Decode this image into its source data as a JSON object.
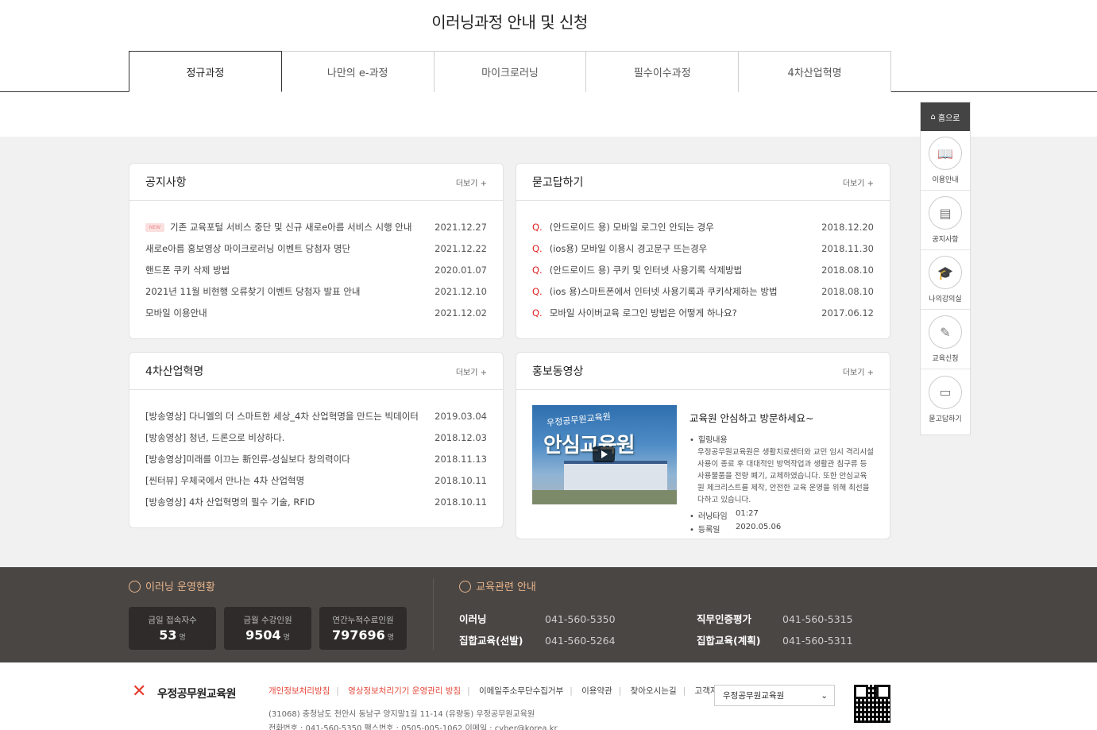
{
  "page_title": "이러닝과정 안내 및 신청",
  "tabs": [
    {
      "label": "정규과정"
    },
    {
      "label": "나만의 e-과정"
    },
    {
      "label": "마이크로러닝"
    },
    {
      "label": "필수이수과정"
    },
    {
      "label": "4차산업혁명"
    }
  ],
  "notice": {
    "title": "공지사항",
    "more": "더보기 +",
    "new_badge": "NEW",
    "items": [
      {
        "title": "기존 교육포털 서비스 중단 및 신규 새로e아름 서비스 시행 안내",
        "date": "2021.12.27"
      },
      {
        "title": "새로e아름 홍보영상 마이크로러닝 이벤트 당첨자 명단",
        "date": "2021.12.22"
      },
      {
        "title": "핸드폰 쿠키 삭제 방법",
        "date": "2020.01.07"
      },
      {
        "title": "2021년 11월 비현행 오류찾기 이벤트 당첨자 발표 안내",
        "date": "2021.12.10"
      },
      {
        "title": "모바일 이용안내",
        "date": "2021.12.02"
      }
    ]
  },
  "qna": {
    "title": "묻고답하기",
    "more": "더보기 +",
    "q_mark": "Q.",
    "items": [
      {
        "title": "(안드로이드 용) 모바일 로그인 안되는 경우",
        "date": "2018.12.20"
      },
      {
        "title": "(ios용) 모바일 이용시 경고문구 뜨는경우",
        "date": "2018.11.30"
      },
      {
        "title": "(안드로이드 용) 쿠키 및 인터넷 사용기록 삭제방법",
        "date": "2018.08.10"
      },
      {
        "title": "(ios 용)스마트폰에서 인터넷 사용기록과 쿠키삭제하는 방법",
        "date": "2018.08.10"
      },
      {
        "title": "모바일 사이버교육 로그인 방법은 어떻게 하나요?",
        "date": "2017.06.12"
      }
    ]
  },
  "industry": {
    "title": "4차산업혁명",
    "more": "더보기 +",
    "items": [
      {
        "title": "[방송영상] 다니엘의 더 스마트한 세상_4차 산업혁명을 만드는 빅데이터",
        "date": "2019.03.04"
      },
      {
        "title": "[방송영상] 청년, 드론으로 비상하다.",
        "date": "2018.12.03"
      },
      {
        "title": "[방송영상]미래를 이끄는 新인류-성실보다 창의력이다",
        "date": "2018.11.13"
      },
      {
        "title": "[씬터뷰] 우체국에서 만나는 4차 산업혁명",
        "date": "2018.10.11"
      },
      {
        "title": "[방송영상] 4차 산업혁명의 필수 기술, RFID",
        "date": "2018.10.11"
      }
    ]
  },
  "video": {
    "title": "홍보동영상",
    "more": "더보기 +",
    "thumb_sub": "우정공무원교육원",
    "thumb_main": "안심교육원",
    "video_title": "교육원 안심하고 방문하세요~",
    "content_label": "힐링내용",
    "content": "우정공무원교육원은 생활치료센터와 교민 임시 격리시설 사용이 종료 후 대대적인 방역작업과 생활관 침구류 등 사용물품을 전량 폐기, 교체하였습니다. 또한 안심교육원 체크리스트를 제작, 안전한 교육 운영을 위해 최선을 다하고 있습니다.",
    "runtime_label": "러닝타임",
    "runtime": "01:27",
    "reg_label": "등록일",
    "reg_date": "2020.05.06"
  },
  "quick": {
    "home": "홈으로",
    "items": [
      {
        "label": "이용안내",
        "icon": "book-icon"
      },
      {
        "label": "공지사항",
        "icon": "notice-icon"
      },
      {
        "label": "나의강의실",
        "icon": "graduation-icon"
      },
      {
        "label": "교육신청",
        "icon": "pencil-icon"
      },
      {
        "label": "묻고답하기",
        "icon": "monitor-icon"
      }
    ]
  },
  "footer": {
    "status_title": "이러닝 운영현황",
    "stats": [
      {
        "label": "금일 접속자수",
        "value": "53",
        "unit": "명"
      },
      {
        "label": "금월 수강인원",
        "value": "9504",
        "unit": "명"
      },
      {
        "label": "연간누적수료인원",
        "value": "797696",
        "unit": "명"
      }
    ],
    "contact_title": "교육관련 안내",
    "contacts": [
      {
        "label": "이러닝",
        "phone": "041-560-5350"
      },
      {
        "label": "집합교육(선발)",
        "phone": "041-560-5264"
      },
      {
        "label": "직무인증평가",
        "phone": "041-560-5315"
      },
      {
        "label": "집합교육(계획)",
        "phone": "041-560-5311"
      }
    ],
    "logo_text": "우정공무원교육원",
    "links": [
      {
        "label": "개인정보처리방침",
        "red": true
      },
      {
        "label": "영상정보처리기기 운영관리 방침",
        "red": true
      },
      {
        "label": "이메일주소무단수집거부",
        "red": false
      },
      {
        "label": "이용약관",
        "red": false
      },
      {
        "label": "찾아오시는길",
        "red": false
      },
      {
        "label": "고객지",
        "red": false
      }
    ],
    "address": "(31068) 충청남도 천안시 동남구 양지말1길 11-14 (유량동) 우정공무원교육원",
    "tel": "전화번호 : 041-560-5350    팩스번호 : 0505-005-1062    이메일 : cyber@korea.kr",
    "select_value": "우정공무원교육원"
  }
}
